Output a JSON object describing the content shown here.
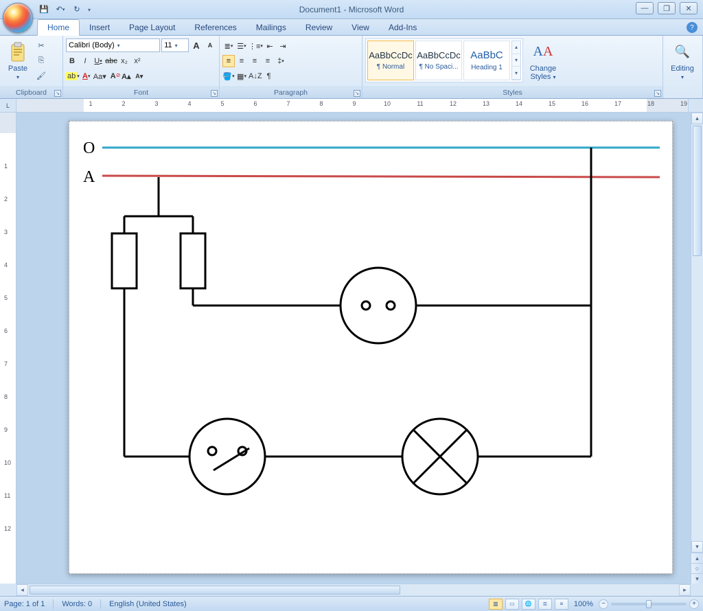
{
  "app": {
    "title": "Document1 - Microsoft Word"
  },
  "qat": {
    "save": "💾",
    "undo": "↶",
    "redo": "↻"
  },
  "tabs": [
    "Home",
    "Insert",
    "Page Layout",
    "References",
    "Mailings",
    "Review",
    "View",
    "Add-Ins"
  ],
  "active_tab": "Home",
  "ribbon": {
    "clipboard": {
      "label": "Clipboard",
      "paste": "Paste"
    },
    "font": {
      "label": "Font",
      "name": "Calibri (Body)",
      "size": "11",
      "bold": "B",
      "italic": "I",
      "underline": "U",
      "strike": "abc",
      "sub": "x₂",
      "sup": "x²",
      "clear": "Aa",
      "case": "Aa▾",
      "grow": "A",
      "shrink": "A"
    },
    "paragraph": {
      "label": "Paragraph"
    },
    "styles": {
      "label": "Styles",
      "items": [
        {
          "sample": "AaBbCcDc",
          "name": "¶ Normal"
        },
        {
          "sample": "AaBbCcDc",
          "name": "¶ No Spaci..."
        },
        {
          "sample": "AaBbC",
          "name": "Heading 1"
        }
      ],
      "change": "Change Styles"
    },
    "editing": {
      "label": "Editing",
      "btn": "Editing"
    }
  },
  "ruler_marks": [
    1,
    2,
    3,
    4,
    5,
    6,
    7,
    8,
    9,
    10,
    11,
    12,
    13,
    14,
    15,
    16,
    17,
    18,
    19
  ],
  "vruler_marks": [
    1,
    2,
    3,
    4,
    5,
    6,
    7,
    8,
    9,
    10,
    11,
    12
  ],
  "status": {
    "page": "Page: 1 of 1",
    "words": "Words: 0",
    "lang": "English (United States)",
    "zoom": "100%"
  },
  "document": {
    "schematic": {
      "labels": {
        "neutral": "O",
        "live": "A"
      }
    }
  }
}
